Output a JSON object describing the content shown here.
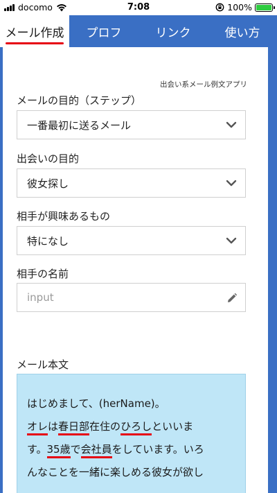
{
  "status_bar": {
    "carrier": "docomo",
    "time": "7:08",
    "battery_text": "100%",
    "battery_level": 1.0,
    "icons": [
      "signal-icon",
      "wifi-icon",
      "rotation-lock-icon",
      "battery-icon"
    ]
  },
  "tabs": [
    {
      "label": "メール作成",
      "active": true
    },
    {
      "label": "プロフ",
      "active": false
    },
    {
      "label": "リンク",
      "active": false
    },
    {
      "label": "使い方",
      "active": false
    }
  ],
  "app_caption": "出会い系メール例文アプリ",
  "fields": {
    "purpose": {
      "label": "メールの目的（ステップ）",
      "value": "一番最初に送るメール"
    },
    "goal": {
      "label": "出会いの目的",
      "value": "彼女探し"
    },
    "interest": {
      "label": "相手が興味あるもの",
      "value": "特になし"
    },
    "name": {
      "label": "相手の名前",
      "placeholder": "input"
    }
  },
  "mail": {
    "label": "メール本文",
    "line1": "はじめまして、(herName)。",
    "seg_ore": "オレ",
    "seg_wa": "は",
    "seg_kasukabe": "春日部",
    "seg_zaiju": "在住の",
    "seg_hiroshi": "ひろし",
    "seg_toiima": "といいま",
    "seg_su": "す。",
    "seg_age": "35歳",
    "seg_de": "で",
    "seg_job": "会社員",
    "seg_rest": "をしています。いろ",
    "line4": "んなことを一緒に楽しめる彼女が欲し"
  },
  "colors": {
    "header_blue": "#3a6fc4",
    "underline_red": "#e60012",
    "mail_bg": "#bfe6f7"
  }
}
